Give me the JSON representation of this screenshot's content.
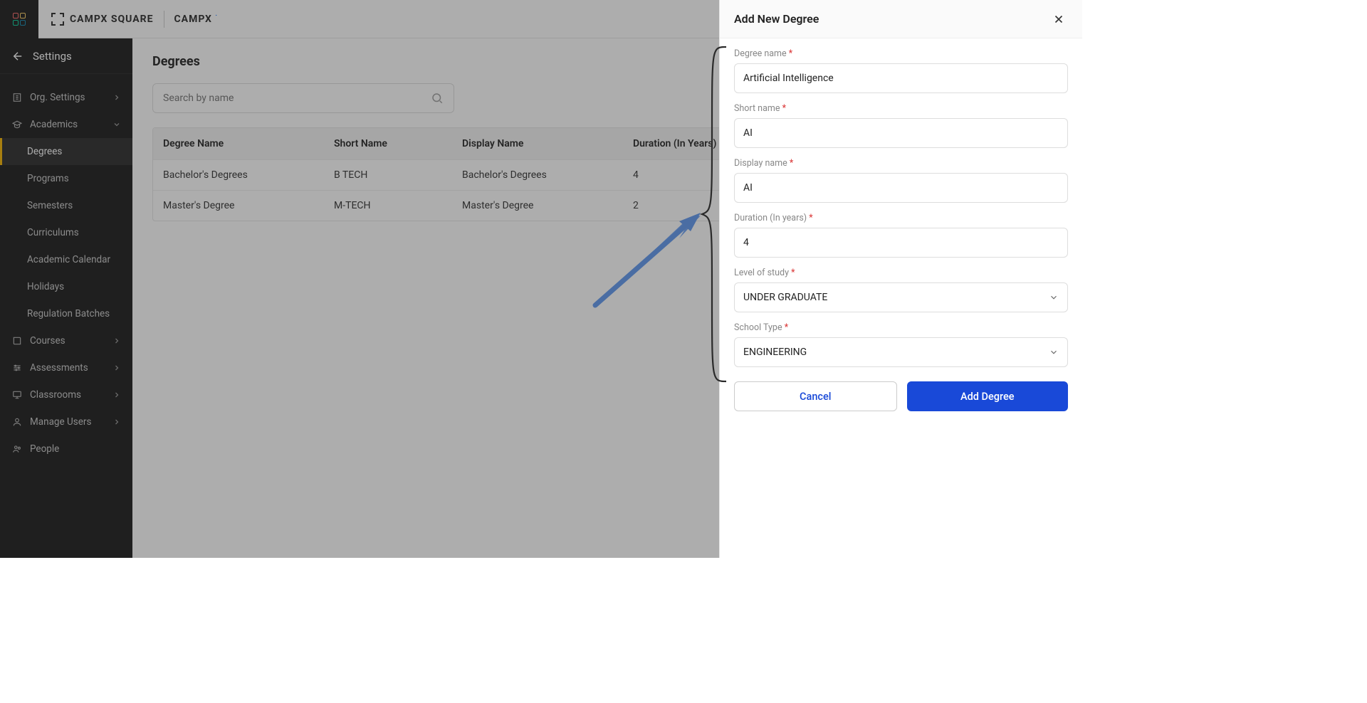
{
  "brand": {
    "square": "CAMPX SQUARE",
    "sub": "CAMPX"
  },
  "sidebar": {
    "title": "Settings",
    "items": [
      {
        "label": "Org. Settings",
        "icon": "org",
        "expandable": true
      },
      {
        "label": "Academics",
        "icon": "academics",
        "expandable": true,
        "expanded": true
      },
      {
        "label": "Courses",
        "icon": "courses",
        "expandable": true
      },
      {
        "label": "Assessments",
        "icon": "assessments",
        "expandable": true
      },
      {
        "label": "Classrooms",
        "icon": "classrooms",
        "expandable": true
      },
      {
        "label": "Manage Users",
        "icon": "users",
        "expandable": true
      },
      {
        "label": "People",
        "icon": "people",
        "expandable": false
      }
    ],
    "academics_sub": [
      {
        "label": "Degrees",
        "active": true
      },
      {
        "label": "Programs"
      },
      {
        "label": "Semesters"
      },
      {
        "label": "Curriculums"
      },
      {
        "label": "Academic Calendar"
      },
      {
        "label": "Holidays"
      },
      {
        "label": "Regulation Batches"
      }
    ]
  },
  "main": {
    "title": "Degrees",
    "search_placeholder": "Search by name",
    "columns": [
      "Degree Name",
      "Short Name",
      "Display Name",
      "Duration (In Years)"
    ],
    "rows": [
      {
        "degree_name": "Bachelor's Degrees",
        "short_name": "B TECH",
        "display_name": "Bachelor's Degrees",
        "duration": "4"
      },
      {
        "degree_name": "Master's Degree",
        "short_name": "M-TECH",
        "display_name": "Master's Degree",
        "duration": "2"
      }
    ]
  },
  "panel": {
    "title": "Add New Degree",
    "fields": {
      "degree_name": {
        "label": "Degree name",
        "value": "Artificial Intelligence"
      },
      "short_name": {
        "label": "Short name",
        "value": "AI"
      },
      "display_name": {
        "label": "Display name",
        "value": "AI"
      },
      "duration": {
        "label": "Duration (In years)",
        "value": "4"
      },
      "level_of_study": {
        "label": "Level of study",
        "value": "UNDER GRADUATE"
      },
      "school_type": {
        "label": "School Type",
        "value": "ENGINEERING"
      }
    },
    "buttons": {
      "cancel": "Cancel",
      "submit": "Add Degree"
    }
  }
}
